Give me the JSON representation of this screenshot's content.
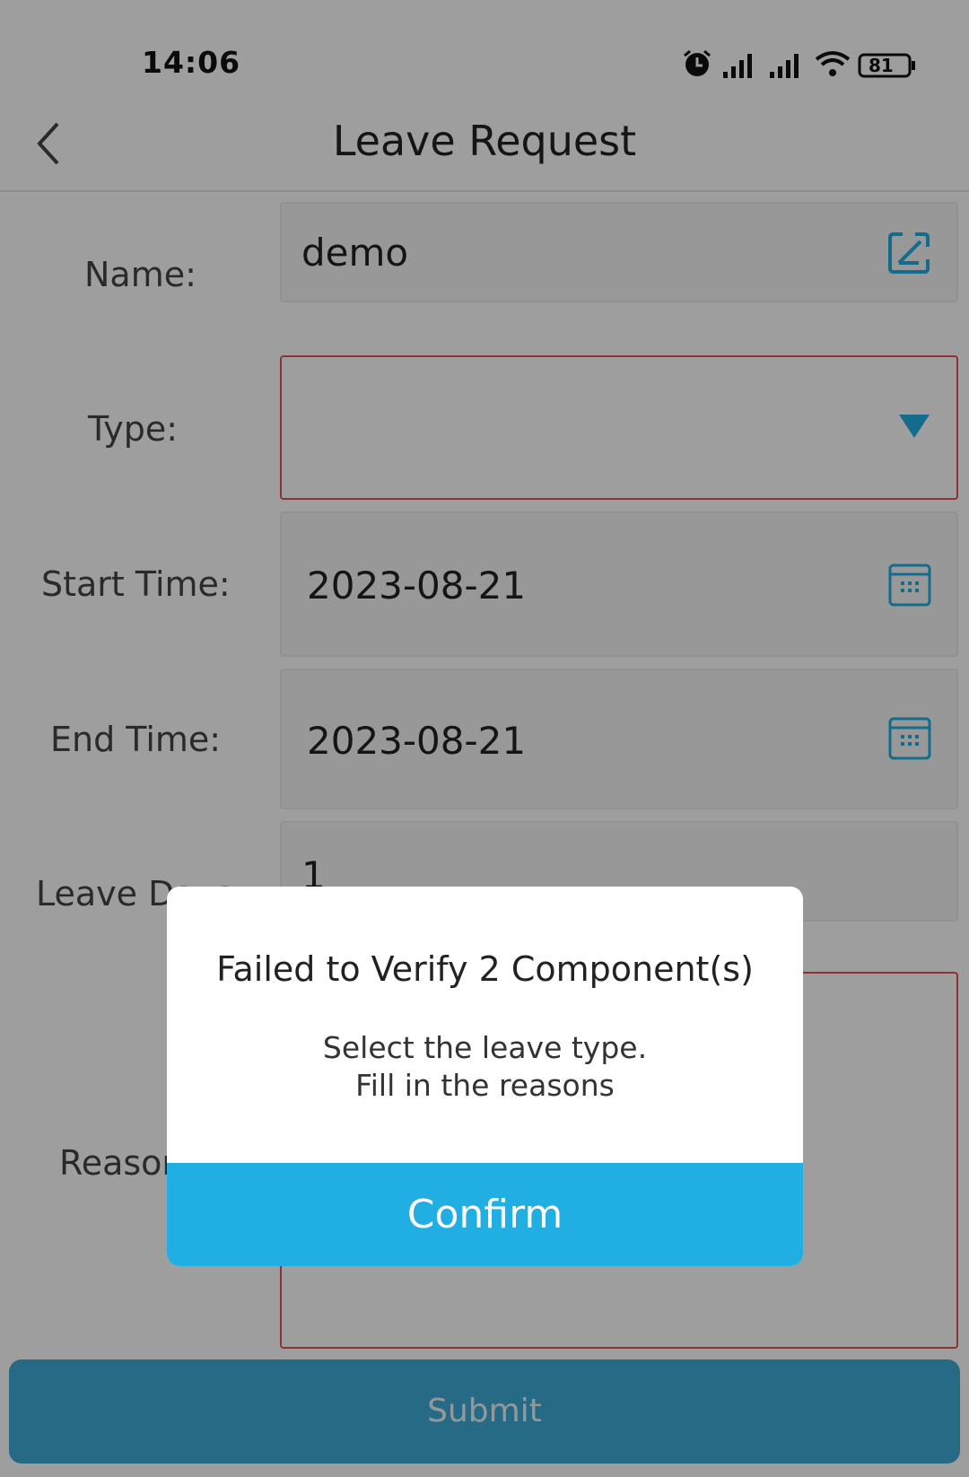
{
  "status_bar": {
    "time": "14:06",
    "battery": "81",
    "icons": [
      "alarm-icon",
      "signal-icon",
      "signal-icon",
      "wifi-icon",
      "battery-icon"
    ]
  },
  "nav": {
    "title": "Leave Request",
    "back_icon": "chevron-left-icon"
  },
  "form": {
    "name": {
      "label": "Name:",
      "value": "demo",
      "icon": "edit-icon"
    },
    "type": {
      "label": "Type:",
      "value": "",
      "icon": "dropdown-triangle-icon"
    },
    "start_time": {
      "label": "Start Time:",
      "value": "2023-08-21",
      "icon": "calendar-icon"
    },
    "end_time": {
      "label": "End Time:",
      "value": "2023-08-21",
      "icon": "calendar-icon"
    },
    "leave_days": {
      "label": "Leave Days:",
      "value": "1"
    },
    "reason": {
      "label": "Reason:",
      "value": ""
    }
  },
  "dialog": {
    "title": "Failed to Verify 2 Component(s)",
    "messages": [
      "Select the leave type.",
      "Fill in the reasons"
    ],
    "confirm_label": "Confirm"
  },
  "submit_label": "Submit",
  "colors": {
    "accent": "#21aee3",
    "error": "#e05252",
    "submit": "#3eabd8"
  }
}
